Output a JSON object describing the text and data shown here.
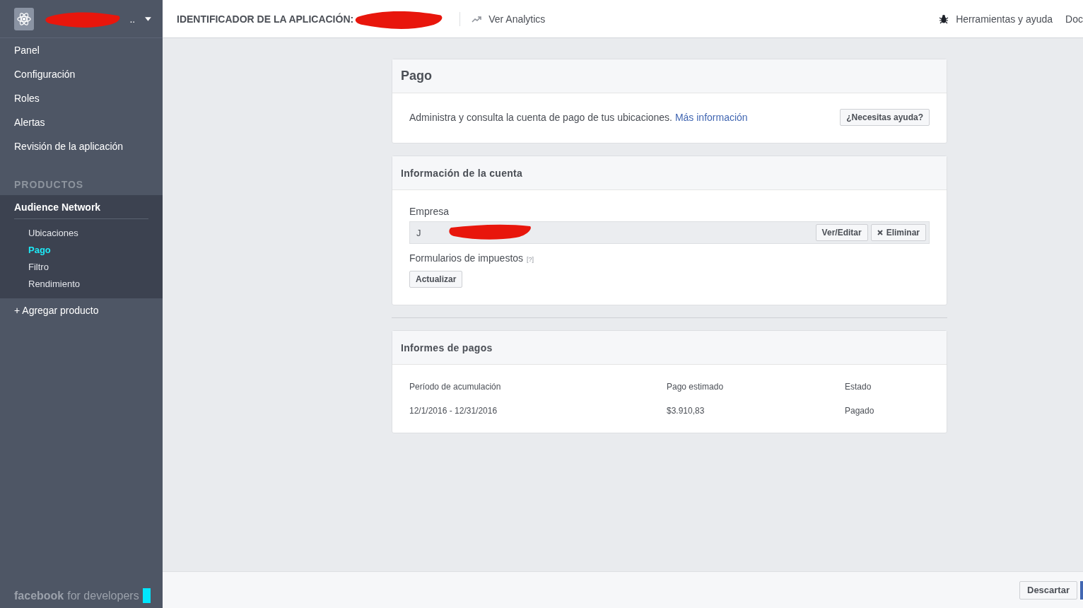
{
  "sidebar": {
    "app_switcher": {
      "suffix": ".."
    },
    "nav": [
      {
        "label": "Panel"
      },
      {
        "label": "Configuración"
      },
      {
        "label": "Roles"
      },
      {
        "label": "Alertas"
      },
      {
        "label": "Revisión de la aplicación"
      }
    ],
    "products_heading": "PRODUCTOS",
    "product": {
      "label": "Audience Network",
      "expanded": true,
      "children": [
        {
          "label": "Ubicaciones",
          "selected": false
        },
        {
          "label": "Pago",
          "selected": true
        },
        {
          "label": "Filtro",
          "selected": false
        },
        {
          "label": "Rendimiento",
          "selected": false
        }
      ]
    },
    "add_product": "+ Agregar producto",
    "footer_logo": {
      "brand": "facebook",
      "tagline": "for developers"
    }
  },
  "top_bar": {
    "app_id_label": "IDENTIFICADOR DE LA APLICACIÓN:",
    "analytics_link": "Ver Analytics",
    "tools_link": "Herramientas y ayuda",
    "docs_link": "Doc"
  },
  "payment_card": {
    "title": "Pago",
    "description": "Administra y consulta la cuenta de pago de tus ubicaciones.",
    "more_link": "Más información",
    "help_button": "¿Necesitas ayuda?"
  },
  "account_card": {
    "title": "Información de la cuenta",
    "company_label": "Empresa",
    "company_value": "J",
    "edit_button": "Ver/Editar",
    "delete_button": "Eliminar",
    "tax_label": "Formularios de impuestos",
    "tax_help": "[?]",
    "update_button": "Actualizar"
  },
  "reports_card": {
    "title": "Informes de pagos",
    "columns": [
      "Período de acumulación",
      "Pago estimado",
      "Estado"
    ],
    "rows": [
      [
        "12/1/2016 - 12/31/2016",
        "$3.910,83",
        "Pagado"
      ]
    ]
  },
  "footer": {
    "discard_button": "Descartar"
  }
}
